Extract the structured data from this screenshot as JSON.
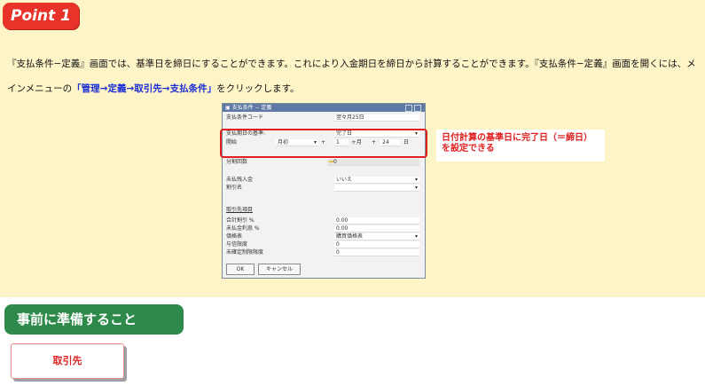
{
  "point_badge": "Point 1",
  "description": {
    "part1": "『支払条件−定義』画面では、基準日を締日にすることができます。これにより入金期日を締日から計算することができます。『支払条件−定義』画面を開くには、メインメニューの",
    "link": "「管理→定義→取引先→支払条件」",
    "part2": "をクリックします。"
  },
  "window": {
    "title": "支払条件 − 定義",
    "code_label": "支払条件コード",
    "code_value": "翌々月25日",
    "basedate_label": "支払期日の基準:",
    "basedate_value": "完了日",
    "start_label": "開始",
    "start_value": "月初",
    "plus1": "+",
    "months_value": "1",
    "months_unit": "ヶ月",
    "plus2": "+",
    "days_value": "24",
    "days_unit": "日",
    "installments_label": "分割回数",
    "installments_value": "0",
    "open_receipt_label": "未払残入金",
    "open_receipt_value": "いいえ",
    "discount_label": "割引名",
    "section_label": "取引先項目",
    "total_discount_label": "合計割引 %",
    "total_discount_value": "0.00",
    "interest_label": "未払金利息 %",
    "interest_value": "0.00",
    "pricelist_label": "価格表",
    "pricelist_value": "購買価格表",
    "credit_limit_label": "与信限度",
    "credit_limit_value": "0",
    "commit_limit_label": "未確定制限限度",
    "commit_limit_value": "0",
    "ok_button": "OK",
    "cancel_button": "キャンセル"
  },
  "callout": "日付計算の基準日に完了日（＝締日）を設定できる",
  "prep_banner": "事前に準備すること",
  "vendor_box": "取引先",
  "colors": {
    "accent_red": "#e8332a",
    "band": "#fdf4c8",
    "green": "#2e8a4a",
    "link_blue": "#1a2fd6"
  }
}
